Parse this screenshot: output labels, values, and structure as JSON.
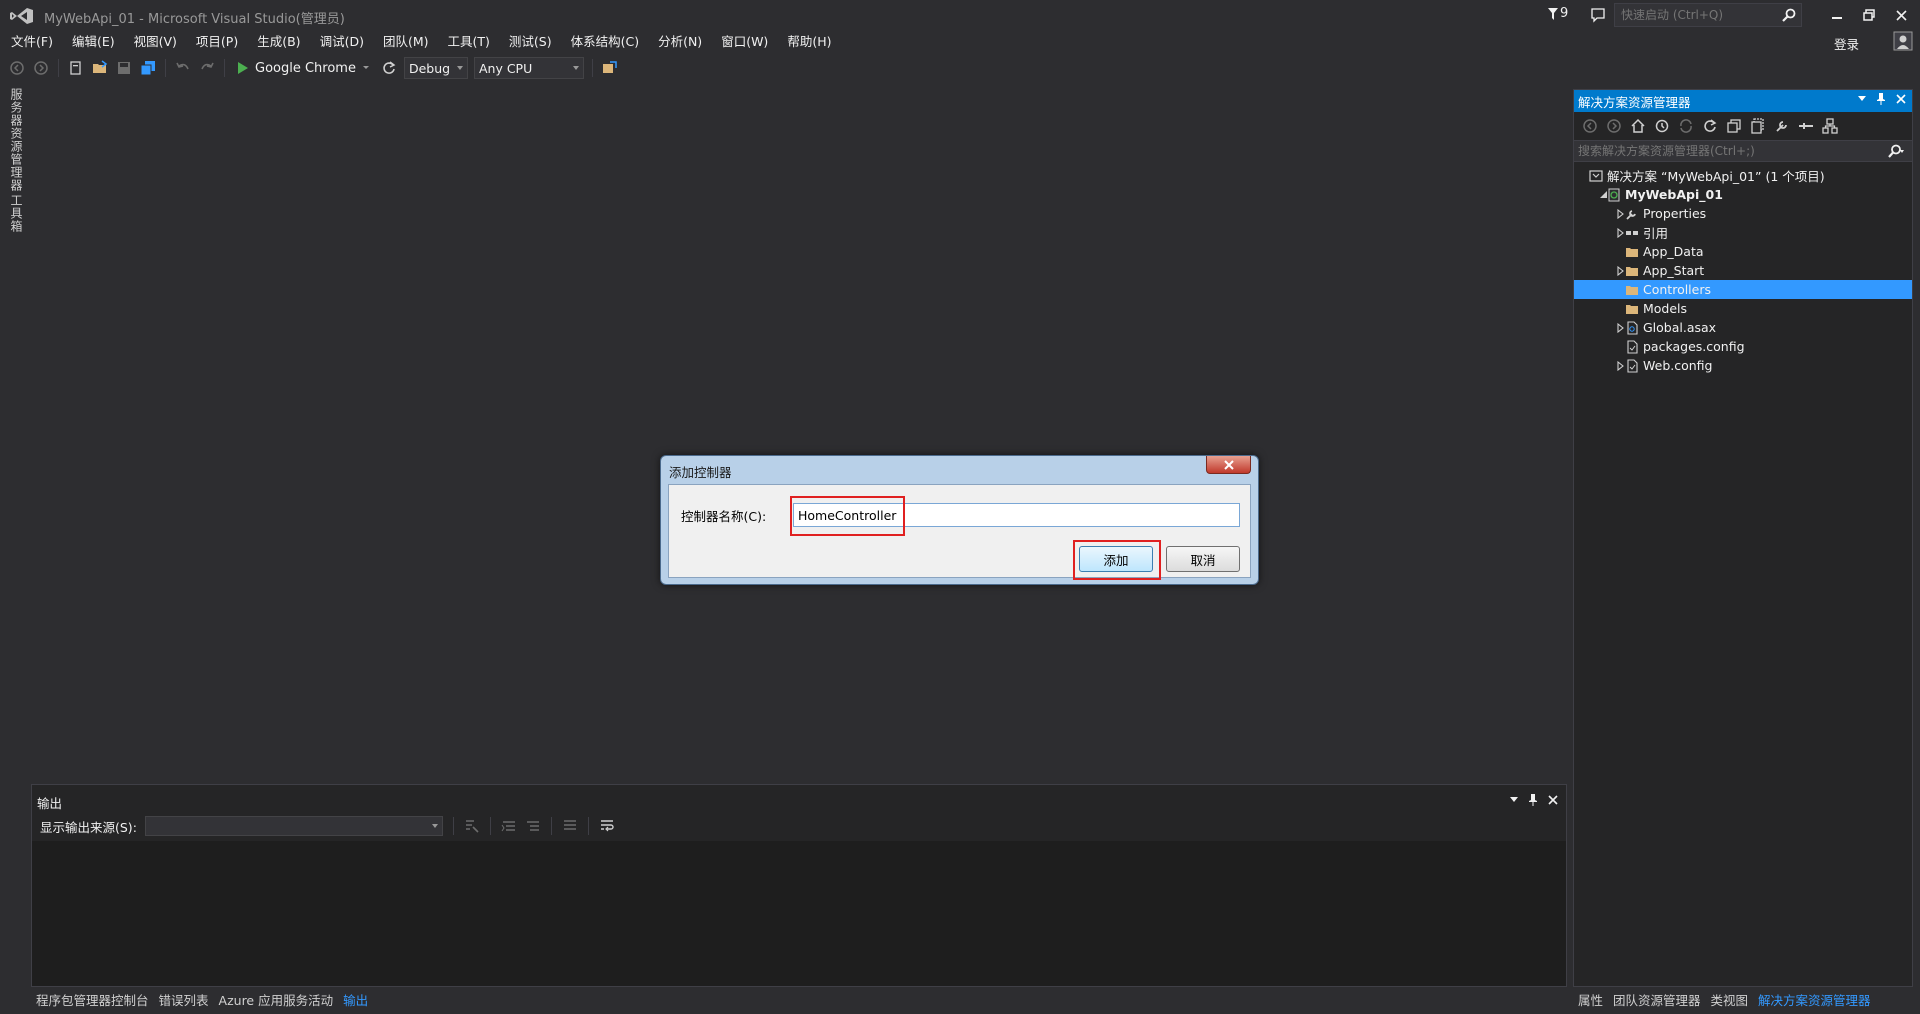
{
  "window": {
    "title": "MyWebApi_01 - Microsoft Visual Studio(管理员)",
    "notification_count": "9",
    "quick_launch_placeholder": "快速启动 (Ctrl+Q)",
    "login_label": "登录"
  },
  "menu": [
    {
      "label": "文件(F)"
    },
    {
      "label": "编辑(E)"
    },
    {
      "label": "视图(V)"
    },
    {
      "label": "项目(P)"
    },
    {
      "label": "生成(B)"
    },
    {
      "label": "调试(D)"
    },
    {
      "label": "团队(M)"
    },
    {
      "label": "工具(T)"
    },
    {
      "label": "测试(S)"
    },
    {
      "label": "体系结构(C)"
    },
    {
      "label": "分析(N)"
    },
    {
      "label": "窗口(W)"
    },
    {
      "label": "帮助(H)"
    }
  ],
  "toolbar": {
    "run_target": "Google Chrome",
    "configuration": "Debug",
    "platform": "Any CPU"
  },
  "left_strip": {
    "server_explorer": "服务器资源管理器",
    "toolbox": "工具箱"
  },
  "solution_explorer": {
    "title": "解决方案资源管理器",
    "search_placeholder": "搜索解决方案资源管理器(Ctrl+;)",
    "items": [
      {
        "label": "解决方案 “MyWebApi_01” (1 个项目)",
        "icon": "solution-icon",
        "expand": "none",
        "level": 0
      },
      {
        "label": "MyWebApi_01",
        "icon": "web-project-icon",
        "expand": "expanded",
        "level": 1,
        "bold": true
      },
      {
        "label": "Properties",
        "icon": "wrench-icon",
        "expand": "collapsed",
        "level": 2
      },
      {
        "label": "引用",
        "icon": "references-icon",
        "expand": "collapsed",
        "level": 2
      },
      {
        "label": "App_Data",
        "icon": "folder-icon",
        "expand": "none",
        "level": 2
      },
      {
        "label": "App_Start",
        "icon": "folder-icon",
        "expand": "collapsed",
        "level": 2
      },
      {
        "label": "Controllers",
        "icon": "folder-icon",
        "expand": "none",
        "level": 2,
        "selected": true
      },
      {
        "label": "Models",
        "icon": "folder-icon",
        "expand": "none",
        "level": 2
      },
      {
        "label": "Global.asax",
        "icon": "asax-file-icon",
        "expand": "collapsed",
        "level": 2
      },
      {
        "label": "packages.config",
        "icon": "config-file-icon",
        "expand": "none",
        "level": 2
      },
      {
        "label": "Web.config",
        "icon": "config-file-icon",
        "expand": "collapsed",
        "level": 2
      }
    ],
    "tabs": [
      {
        "label": "属性"
      },
      {
        "label": "团队资源管理器"
      },
      {
        "label": "类视图"
      },
      {
        "label": "解决方案资源管理器",
        "active": true
      }
    ]
  },
  "output": {
    "title": "输出",
    "source_label": "显示输出来源(S):",
    "source_value": ""
  },
  "bottom_tabs": [
    {
      "label": "程序包管理器控制台"
    },
    {
      "label": "错误列表"
    },
    {
      "label": "Azure 应用服务活动"
    },
    {
      "label": "输出",
      "active": true
    }
  ],
  "dialog": {
    "title": "添加控制器",
    "field_label": "控制器名称(C):",
    "field_value": "HomeController",
    "add_label": "添加",
    "cancel_label": "取消"
  },
  "colors": {
    "accent": "#007acc",
    "selection": "#3399ff",
    "highlight": "#e02020",
    "folder": "#dcb67a"
  }
}
